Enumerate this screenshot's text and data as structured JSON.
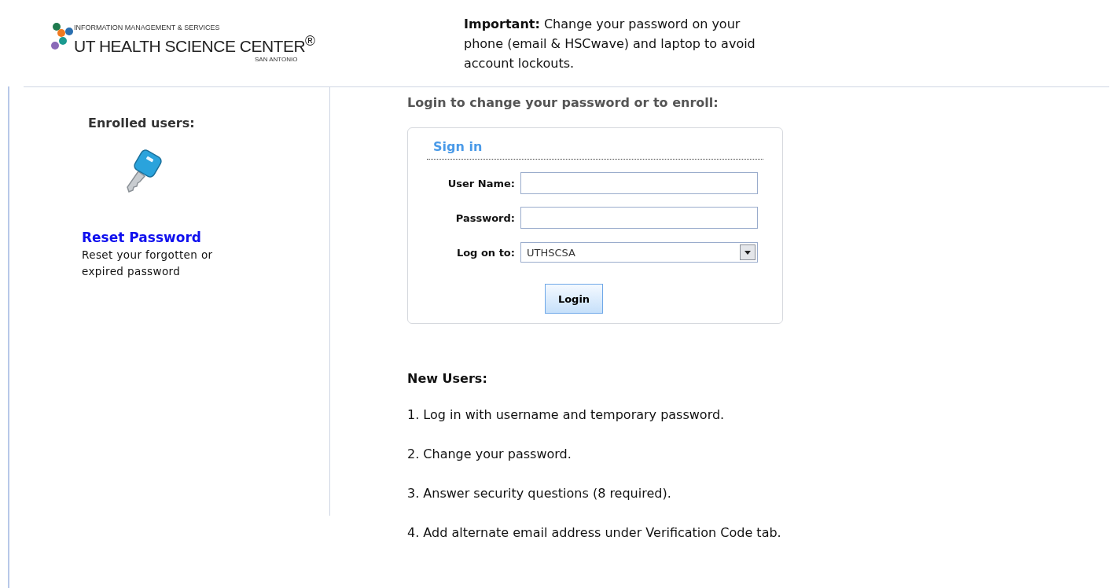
{
  "logo": {
    "department": "INFORMATION MANAGEMENT & SERVICES",
    "name": "UT HEALTH SCIENCE CENTER$^{®}$",
    "location": "SAN ANTONIO"
  },
  "notice": "**Important:** Change your password on your phone (email & HSCwave) and laptop to avoid account lockouts.",
  "sidebar": {
    "heading": "Enrolled users:",
    "link": "Reset Password",
    "description": "Reset your forgotten or expired password"
  },
  "login": {
    "heading": "Login to change your password or to enroll:",
    "title": "Sign in",
    "fields": [
      {
        "kind": "text",
        "label": "User Name:"
      },
      {
        "kind": "password",
        "label": "Password:"
      },
      {
        "kind": "select",
        "label": "Log on to:",
        "value": "UTHSCSA"
      }
    ],
    "button": "Login"
  },
  "new_users": {
    "heading": "New Users:",
    "steps": [
      "1. Log in with username and temporary password.",
      "2. Change your password.",
      "3. Answer security questions (8 required).",
      "4. Add alternate email address under Verification Code tab."
    ]
  }
}
